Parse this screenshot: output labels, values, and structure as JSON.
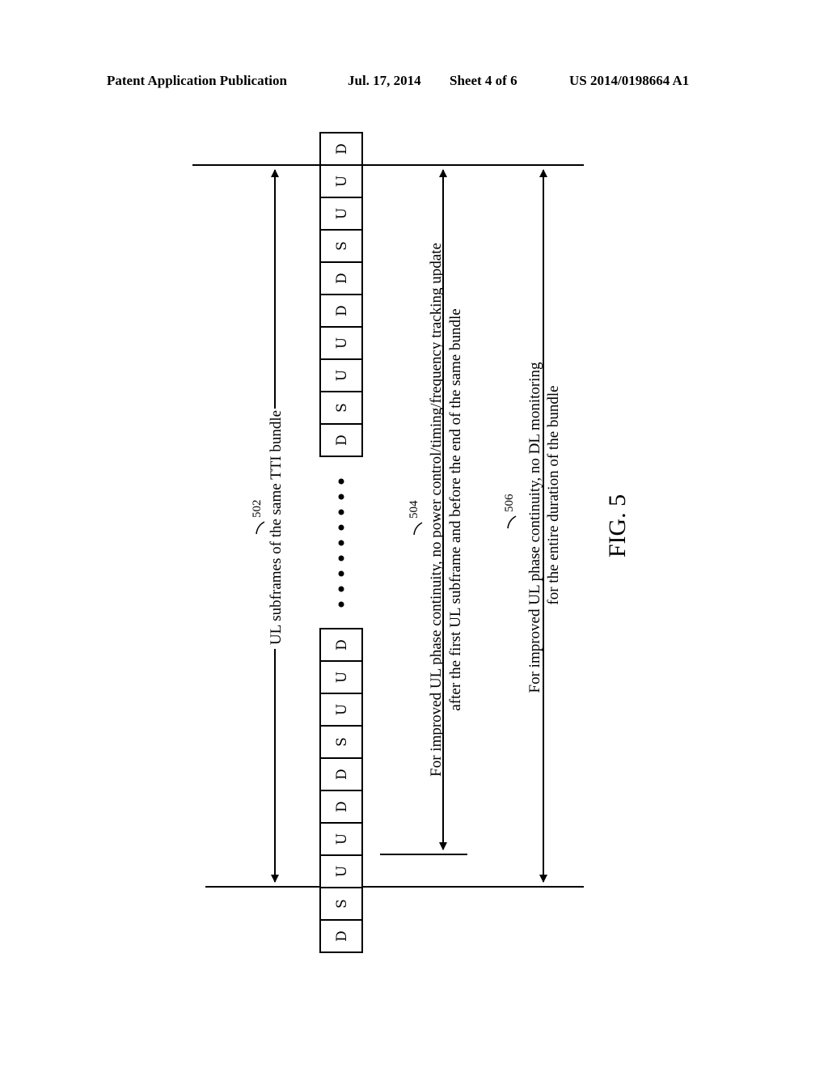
{
  "header": {
    "publication": "Patent Application Publication",
    "date": "Jul. 17, 2014",
    "sheet": "Sheet 4 of 6",
    "number": "US 2014/0198664 A1"
  },
  "figure": {
    "caption": "FIG. 5",
    "frames_top_group": [
      "D",
      "U",
      "U",
      "S",
      "D",
      "D",
      "U",
      "U",
      "S",
      "D"
    ],
    "frames_bottom_group": [
      "D",
      "U",
      "U",
      "S",
      "D",
      "D",
      "U",
      "U",
      "S",
      "D"
    ],
    "ellipsis_dots": 9,
    "annotations": [
      {
        "ref": "502",
        "lines": [
          "UL subframes of the same TTI bundle"
        ]
      },
      {
        "ref": "504",
        "lines": [
          "For improved UL phase continuity, no power control/timing/frequency tracking update",
          "after the first UL subframe and before the end of the same bundle"
        ]
      },
      {
        "ref": "506",
        "lines": [
          "For improved UL phase continuity, no DL monitoring",
          "for the entire duration of the bundle"
        ]
      }
    ]
  }
}
